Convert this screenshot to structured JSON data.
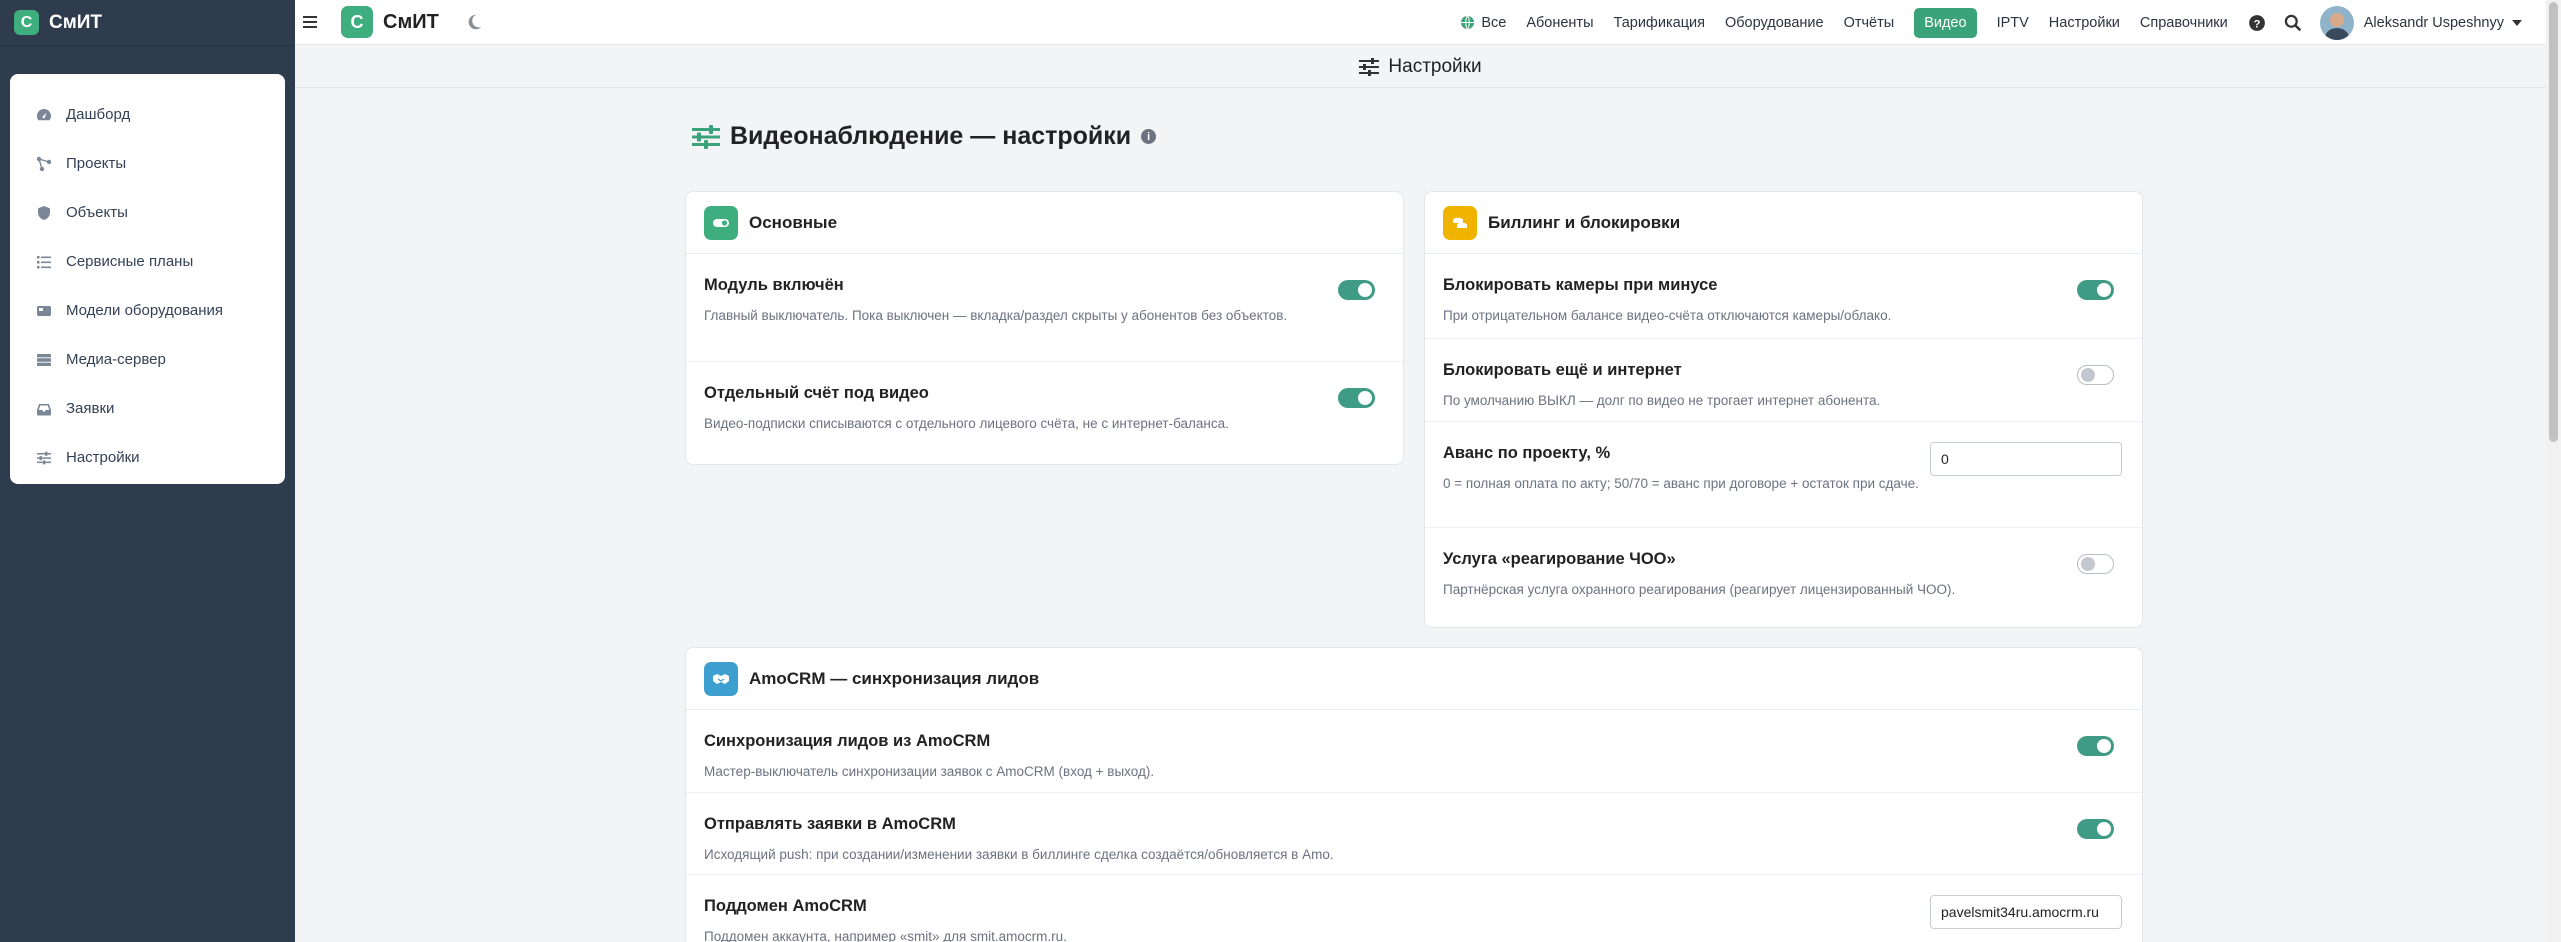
{
  "brand": {
    "logo_letter": "С",
    "name": "СмИТ"
  },
  "sidebar": {
    "items": [
      {
        "label": "Дашборд",
        "icon": "dashboard-icon"
      },
      {
        "label": "Проекты",
        "icon": "projects-icon"
      },
      {
        "label": "Объекты",
        "icon": "shield-icon"
      },
      {
        "label": "Сервисные планы",
        "icon": "list-icon"
      },
      {
        "label": "Модели оборудования",
        "icon": "device-icon"
      },
      {
        "label": "Медиа-сервер",
        "icon": "server-icon"
      },
      {
        "label": "Заявки",
        "icon": "inbox-icon"
      },
      {
        "label": "Настройки",
        "icon": "sliders-icon"
      }
    ]
  },
  "topnav": {
    "all": "Все",
    "subscribers": "Абоненты",
    "tariffs": "Тарификация",
    "equipment": "Оборудование",
    "reports": "Отчёты",
    "video": "Видео",
    "iptv": "IPTV",
    "settings": "Настройки",
    "directories": "Справочники",
    "user_name": "Aleksandr Uspeshnyy",
    "active_color": "#3aa37a"
  },
  "subheader": {
    "title": "Настройки"
  },
  "page": {
    "title": "Видеонаблюдение — настройки",
    "info": "i"
  },
  "cards": {
    "main": {
      "title": "Основные",
      "icon_color": "#3fae7e",
      "rows": [
        {
          "title": "Модуль включён",
          "desc": "Главный выключатель. Пока выключен — вкладка/раздел скрыты у абонентов без объектов.",
          "enabled": true
        },
        {
          "title": "Отдельный счёт под видео",
          "desc": "Видео-подписки списываются с отдельного лицевого счёта, не с интернет-баланса.",
          "enabled": true
        }
      ]
    },
    "billing": {
      "title": "Биллинг и блокировки",
      "icon_color": "#f0b400",
      "rows": [
        {
          "title": "Блокировать камеры при минусе",
          "desc": "При отрицательном балансе видео-счёта отключаются камеры/облако.",
          "enabled": true
        },
        {
          "title": "Блокировать ещё и интернет",
          "desc": "По умолчанию ВЫКЛ — долг по видео не трогает интернет абонента.",
          "enabled": false
        },
        {
          "title": "Аванс по проекту, %",
          "desc": "0 = полная оплата по акту; 50/70 = аванс при договоре + остаток при сдаче.",
          "value": "0"
        },
        {
          "title": "Услуга «реагирование ЧОО»",
          "desc": "Партнёрская услуга охранного реагирования (реагирует лицензированный ЧОО).",
          "enabled": false
        }
      ]
    },
    "amocrm": {
      "title": "AmoCRM — синхронизация лидов",
      "icon_color": "#3d9fd0",
      "rows": [
        {
          "title": "Синхронизация лидов из AmoCRM",
          "desc": "Мастер-выключатель синхронизации заявок с AmoCRM (вход + выход).",
          "enabled": true
        },
        {
          "title": "Отправлять заявки в AmoCRM",
          "desc": "Исходящий push: при создании/изменении заявки в биллинге сделка создаётся/обновляется в Amo.",
          "enabled": true
        },
        {
          "title": "Поддомен AmoCRM",
          "desc": "Поддомен аккаунта, например «smit» для smit.amocrm.ru.",
          "value": "pavelsmit34ru.amocrm.ru"
        }
      ]
    }
  }
}
